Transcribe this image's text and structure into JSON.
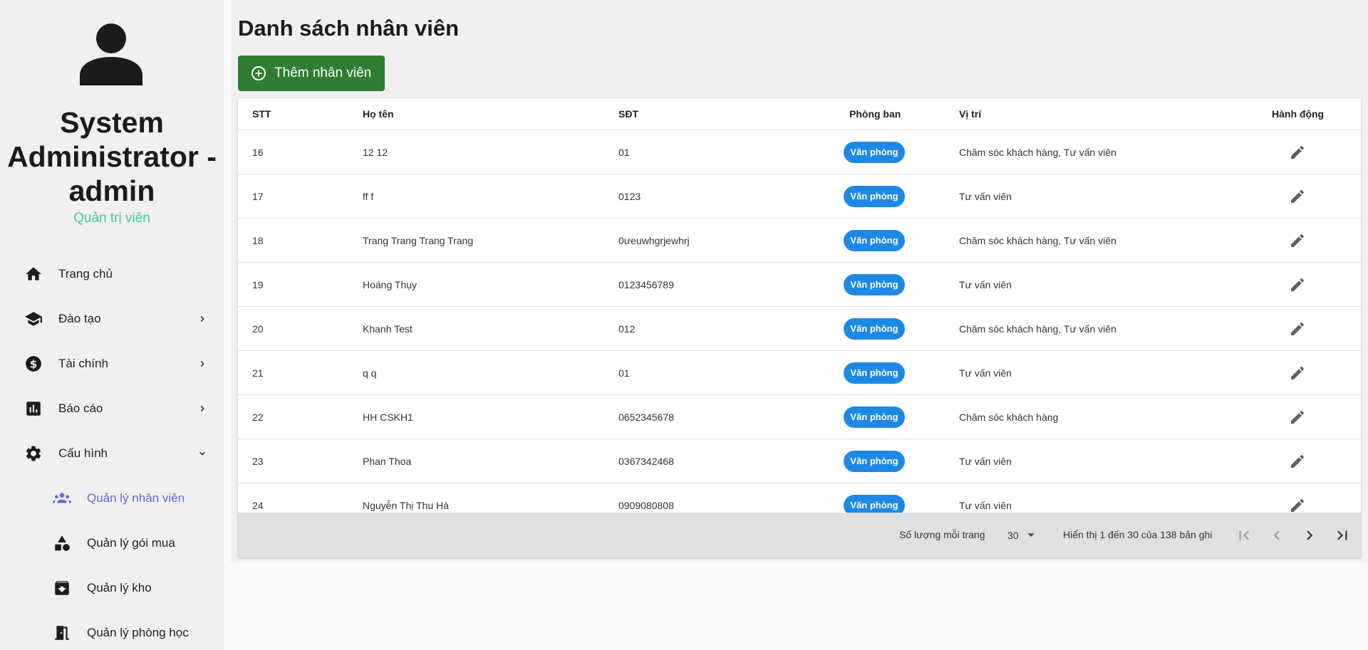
{
  "user": {
    "name": "System Administrator - admin",
    "role": "Quản trị viên"
  },
  "nav": {
    "items": [
      {
        "label": "Trang chủ",
        "icon": "home-icon"
      },
      {
        "label": "Đào tạo",
        "icon": "school-icon"
      },
      {
        "label": "Tài chính",
        "icon": "money-icon"
      },
      {
        "label": "Báo cáo",
        "icon": "report-icon"
      },
      {
        "label": "Cấu hình",
        "icon": "gear-icon"
      }
    ],
    "sub_items": [
      {
        "label": "Quản lý nhân viên",
        "icon": "people-icon",
        "active": true
      },
      {
        "label": "Quản lý gói mua",
        "icon": "shapes-icon"
      },
      {
        "label": "Quản lý kho",
        "icon": "archive-icon"
      },
      {
        "label": "Quản lý phòng học",
        "icon": "door-icon"
      }
    ]
  },
  "page": {
    "title": "Danh sách nhân viên",
    "add_button": "Thêm nhân viên"
  },
  "table": {
    "headers": {
      "stt": "STT",
      "name": "Họ tên",
      "phone": "SĐT",
      "department": "Phòng ban",
      "position": "Vị trí",
      "action": "Hành động"
    },
    "rows": [
      {
        "stt": "16",
        "name": "12 12",
        "phone": "01",
        "department": "Văn phòng",
        "position": "Chăm sóc khách hàng, Tư vấn viên"
      },
      {
        "stt": "17",
        "name": "ff f",
        "phone": "0123",
        "department": "Văn phòng",
        "position": "Tư vấn viên"
      },
      {
        "stt": "18",
        "name": "Trang Trang Trang Trang",
        "phone": "0ưeuwhgrjewhrj",
        "department": "Văn phòng",
        "position": "Chăm sóc khách hàng, Tư vấn viên"
      },
      {
        "stt": "19",
        "name": "Hoàng Thụy",
        "phone": "0123456789",
        "department": "Văn phòng",
        "position": "Tư vấn viên"
      },
      {
        "stt": "20",
        "name": "Khanh Test",
        "phone": "012",
        "department": "Văn phòng",
        "position": "Chăm sóc khách hàng, Tư vấn viên"
      },
      {
        "stt": "21",
        "name": "q q",
        "phone": "01",
        "department": "Văn phòng",
        "position": "Tư vấn viên"
      },
      {
        "stt": "22",
        "name": "HH CSKH1",
        "phone": "0652345678",
        "department": "Văn phòng",
        "position": "Chăm sóc khách hàng"
      },
      {
        "stt": "23",
        "name": "Phan Thoa",
        "phone": "0367342468",
        "department": "Văn phòng",
        "position": "Tư vấn viên"
      },
      {
        "stt": "24",
        "name": "Nguyễn Thị Thu Hà",
        "phone": "0909080808",
        "department": "Văn phòng",
        "position": "Tư vấn viên"
      }
    ]
  },
  "footer": {
    "rows_per_page_label": "Số lượng mỗi trang",
    "rows_per_page": "30",
    "range_text": "Hiển thị 1 đến 30 của 138 bản ghi"
  },
  "colors": {
    "accent": "#5e6ad2",
    "add_button": "#2e7d32",
    "badge": "#1e88e5",
    "role": "#3ec9a7"
  }
}
